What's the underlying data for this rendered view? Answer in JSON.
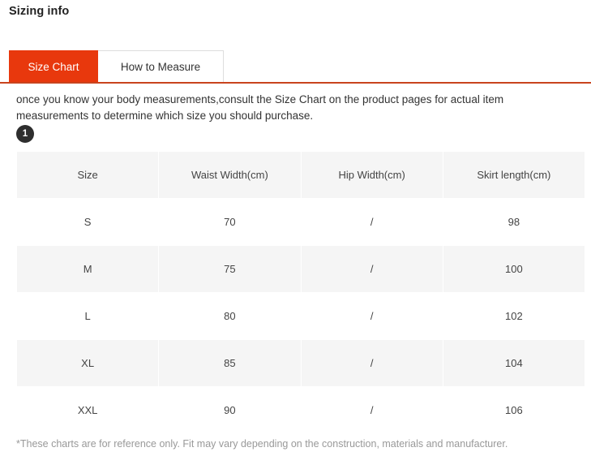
{
  "header": {
    "title": "Sizing info"
  },
  "tabs": {
    "items": [
      {
        "label": "Size Chart",
        "active": true
      },
      {
        "label": "How to Measure",
        "active": false
      }
    ],
    "active_color": "#e8380d",
    "underline_color": "#c9441e"
  },
  "description": {
    "text": "once you know your body measurements,consult the Size Chart on the product pages for actual item measurements to determine which size you should purchase."
  },
  "step_badge": {
    "label": "1",
    "background": "#2e2e2e",
    "color": "#ffffff"
  },
  "size_table": {
    "columns": [
      "Size",
      "Waist Width(cm)",
      "Hip Width(cm)",
      "Skirt length(cm)"
    ],
    "rows": [
      {
        "cells": [
          "S",
          "70",
          "/",
          "98"
        ],
        "shaded": false
      },
      {
        "cells": [
          "M",
          "75",
          "/",
          "100"
        ],
        "shaded": true
      },
      {
        "cells": [
          "L",
          "80",
          "/",
          "102"
        ],
        "shaded": false
      },
      {
        "cells": [
          "XL",
          "85",
          "/",
          "104"
        ],
        "shaded": true
      },
      {
        "cells": [
          "XXL",
          "90",
          "/",
          "106"
        ],
        "shaded": false
      }
    ],
    "header_background": "#f5f5f5",
    "shaded_background": "#f5f5f5"
  },
  "footnote": {
    "text": "*These charts are for reference only. Fit may vary depending on the construction, materials and manufacturer."
  }
}
